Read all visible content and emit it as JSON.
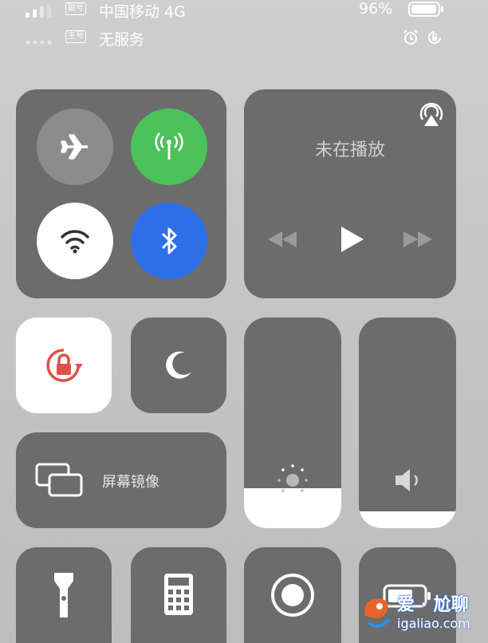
{
  "status_bar": {
    "sim1_badge": "副号",
    "sim1_carrier": "中国移动 4G",
    "sim2_badge": "主号",
    "sim2_carrier": "无服务",
    "battery_percent": "96%",
    "battery_level": 0.96
  },
  "media": {
    "now_playing": "未在播放"
  },
  "screen_mirroring": {
    "label": "屏幕镜像"
  },
  "sliders": {
    "brightness_level": 0.19,
    "volume_level": 0.08
  },
  "watermark": {
    "brand": "爱 · 尬聊",
    "url": "igaliao.com"
  },
  "colors": {
    "cellular_active": "#4cc25a",
    "bluetooth_active": "#2d6fe8",
    "tile_bg": "#6c6c6c",
    "lock_red": "#e0504a"
  },
  "icons": [
    "airplane-icon",
    "cellular-icon",
    "wifi-icon",
    "bluetooth-icon",
    "airplay-icon",
    "rewind-icon",
    "play-icon",
    "forward-icon",
    "orientation-lock-icon",
    "moon-icon",
    "screen-mirror-icon",
    "brightness-icon",
    "volume-icon",
    "flashlight-icon",
    "calculator-icon",
    "record-icon",
    "battery-icon"
  ]
}
